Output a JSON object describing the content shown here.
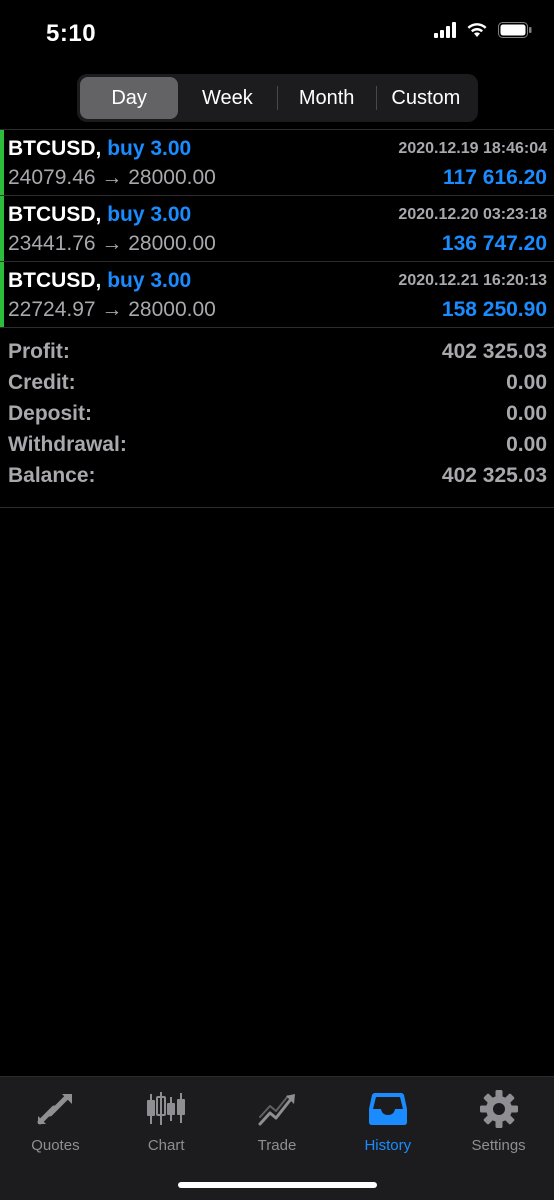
{
  "status_bar": {
    "time": "5:10"
  },
  "period_tabs": [
    {
      "label": "Day",
      "active": true
    },
    {
      "label": "Week",
      "active": false
    },
    {
      "label": "Month",
      "active": false
    },
    {
      "label": "Custom",
      "active": false
    }
  ],
  "deals": [
    {
      "symbol": "BTCUSD,",
      "side": "buy 3.00",
      "time": "2020.12.19 18:46:04",
      "prices": "24079.46 → 28000.00",
      "profit": "117 616.20"
    },
    {
      "symbol": "BTCUSD,",
      "side": "buy 3.00",
      "time": "2020.12.20 03:23:18",
      "prices": "23441.76 → 28000.00",
      "profit": "136 747.20"
    },
    {
      "symbol": "BTCUSD,",
      "side": "buy 3.00",
      "time": "2020.12.21 16:20:13",
      "prices": "22724.97 → 28000.00",
      "profit": "158 250.90"
    }
  ],
  "summary": [
    {
      "label": "Profit:",
      "value": "402 325.03"
    },
    {
      "label": "Credit:",
      "value": "0.00"
    },
    {
      "label": "Deposit:",
      "value": "0.00"
    },
    {
      "label": "Withdrawal:",
      "value": "0.00"
    },
    {
      "label": "Balance:",
      "value": "402 325.03"
    }
  ],
  "tab_bar": [
    {
      "label": "Quotes",
      "icon": "quotes-arrows-icon",
      "active": false
    },
    {
      "label": "Chart",
      "icon": "candlestick-chart-icon",
      "active": false
    },
    {
      "label": "Trade",
      "icon": "trade-trend-icon",
      "active": false
    },
    {
      "label": "History",
      "icon": "inbox-tray-icon",
      "active": true
    },
    {
      "label": "Settings",
      "icon": "gear-icon",
      "active": false
    }
  ],
  "colors": {
    "accent": "#1a8cff",
    "buy_bar": "#2bbd3b",
    "muted_text": "#a8a8ad",
    "tab_inactive": "#8e8e93"
  }
}
